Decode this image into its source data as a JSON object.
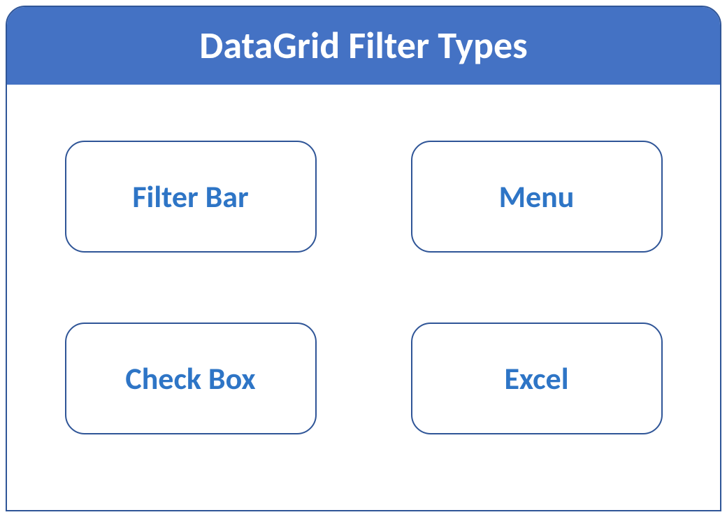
{
  "panel": {
    "title": "DataGrid Filter Types",
    "items": [
      {
        "label": "Filter Bar"
      },
      {
        "label": "Menu"
      },
      {
        "label": "Check Box"
      },
      {
        "label": "Excel"
      }
    ]
  },
  "colors": {
    "header_bg": "#4472c4",
    "border": "#2f5597",
    "tile_text": "#2e75c6"
  }
}
